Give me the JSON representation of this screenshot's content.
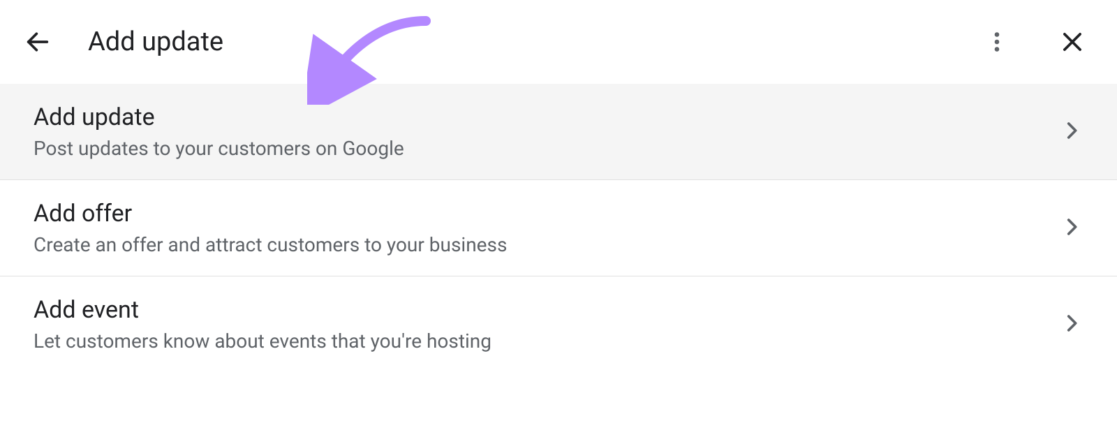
{
  "header": {
    "title": "Add update"
  },
  "items": [
    {
      "title": "Add update",
      "description": "Post updates to your customers on Google",
      "highlighted": true
    },
    {
      "title": "Add offer",
      "description": "Create an offer and attract customers to your business",
      "highlighted": false
    },
    {
      "title": "Add event",
      "description": "Let customers know about events that you're hosting",
      "highlighted": false
    }
  ],
  "colors": {
    "annotation_arrow": "#b388ff"
  }
}
